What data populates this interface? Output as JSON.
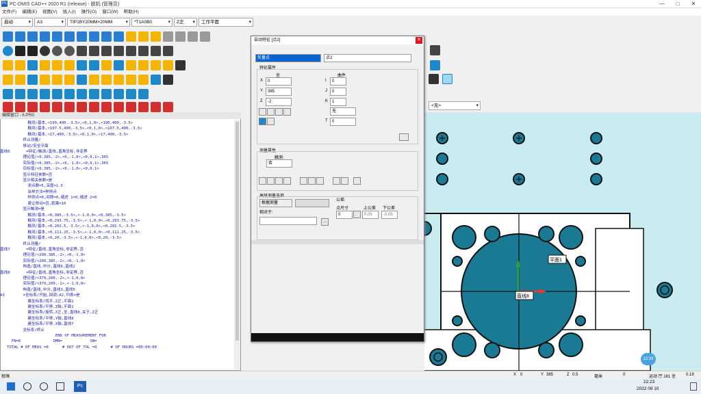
{
  "window": {
    "title": "PC-DMIS CAD++ 2020 R1 (release) - 脱机 (管理员)",
    "app_icon": "Pc",
    "controls": [
      "—",
      "□",
      "✕"
    ]
  },
  "menu": [
    "文件(F)",
    "编辑(E)",
    "视图(V)",
    "插入(I)",
    "操作(O)",
    "窗口(W)",
    "帮助(H)"
  ],
  "combos": {
    "mode": "启动",
    "probe_file": "A3",
    "tip": "TIP1BY20MM×20MM",
    "tip2": "*T1A0B0",
    "view": "Z正",
    "plane": "工作平面"
  },
  "editor": {
    "title": "编辑窗口 - 6.PRG",
    "lines": [
      "            触测/基本,<190,400,-3.5>,<0,1,0>,<190,400,-3.5>",
      "            触测/基本,<107.5,400,-3.5>,<0,1,0>,<107.5,400,-3.5>",
      "            触测/基本,<17,400,-3.5>,<0,1,0>,<17,400,-3.5>",
      "          终止测量/",
      "          移动/安全平面",
      "直线6       =特征/触测/直线,直角坐标,非定界",
      "          理论值/<0,385,-2>,<0,-1,0>,<0,0,1>,365",
      "          实际值/<0,385,-2>,<0,-1,0>,<0,0,1>,365",
      "          目标值/<0,385,-2>,<0,-1,0>,<0,0,1>",
      "          显示特征参数=否",
      "          显示相关参数=是",
      "            测点数=5,深度=1.5",
      "            采样方法=样例点",
      "            样例点=0,间隙=0,缩进 1=0,缩进 2=0",
      "            避让移动=否,距离=10",
      "          显示触测=是",
      "            触测/基本,<0,385,-3.5>,<-1,0,0>,<0,385,-3.5>",
      "            触测/基本,<0,293.75,-3.5>,<-1,0,0>,<0,293.75,-3.5>",
      "            触测/基本,<0,202.5,-3.5>,<-1,0,0>,<0,202.5,-3.5>",
      "            触测/基本,<0,111.25,-3.5>,<-1,0,0>,<0,111.25,-3.5>",
      "            触测/基本,<0,20,-3.5>,<-1,0,0>,<0,20,-3.5>",
      "          终止测量/",
      "直线7       =特征/直线,直角坐标,非定界,否",
      "          理论值/<200,385,-2>,<0,-1,0>",
      "          实际值/<200,385,-2>,<0,-1,0>",
      "          构造/直线,中分,直线6,直线2",
      "直线8       =特征/直线,直角坐标,非定界,否",
      "          理论值/<379,200,-2>,<-1,0,0>",
      "          实际值/<379,200,-2>,<-1,0,0>",
      "          构造/直线,中分,直线3,直线5",
      "A3        =坐标系/开始,回调:A2,列表=是",
      "            建坐标系/找平,Z正,平面1",
      "            建坐标系/平移,Z轴,平面1",
      "            建坐标系/旋转,X正,至,直线8,关于,Z正",
      "            建坐标系/平移,Y轴,直线8",
      "            建坐标系/平移,X轴,直线7",
      "          坐标系/终止",
      "                        END OF MEASUREMENT FOR",
      "     FN=6              DMN=            SN=",
      "   TOTAL # OF MEAS =0      # OUT OF TOL =0      # OF HOURS =00:00:00"
    ]
  },
  "dialog": {
    "title": "自动特征 [点2]",
    "type_value": "矢量点",
    "id_value": "点2",
    "feature_props": "特征属性",
    "theory_hdr": "坐",
    "surface_hdr": "曲件",
    "x": "0",
    "y": "385",
    "z": "-2",
    "i": "0",
    "j": "0",
    "k": "1",
    "t": "0",
    "vec_combo": "无",
    "measure_props": "测量属性",
    "touch_label": "触测:",
    "touch_value": "否",
    "adv_title": "高级测量选项",
    "adv_combo": "根据测量",
    "tol_label": "公差:",
    "nominal_label": "点尺寸",
    "upper_label": "上公差",
    "lower_label": "下公差",
    "nominal": "0",
    "upper": "0.05",
    "lower": "-0.05",
    "relative_label": "相对于:",
    "browse": "..."
  },
  "cad": {
    "label_plane": "平面1",
    "label_line": "直线8",
    "clock_badge": "12:33",
    "coord_combo": "<无>"
  },
  "status": {
    "left": "就绪",
    "x_label": "X",
    "x": "0",
    "y_label": "Y",
    "y": "385",
    "z_label": "Z",
    "z": "0.5",
    "units_label": "毫米",
    "units": "0",
    "right": "运动 厅.181 坐",
    "right2": "0.19"
  },
  "taskbar": {
    "time": "22:23",
    "date": "2022 09 10",
    "app": "Pc"
  }
}
